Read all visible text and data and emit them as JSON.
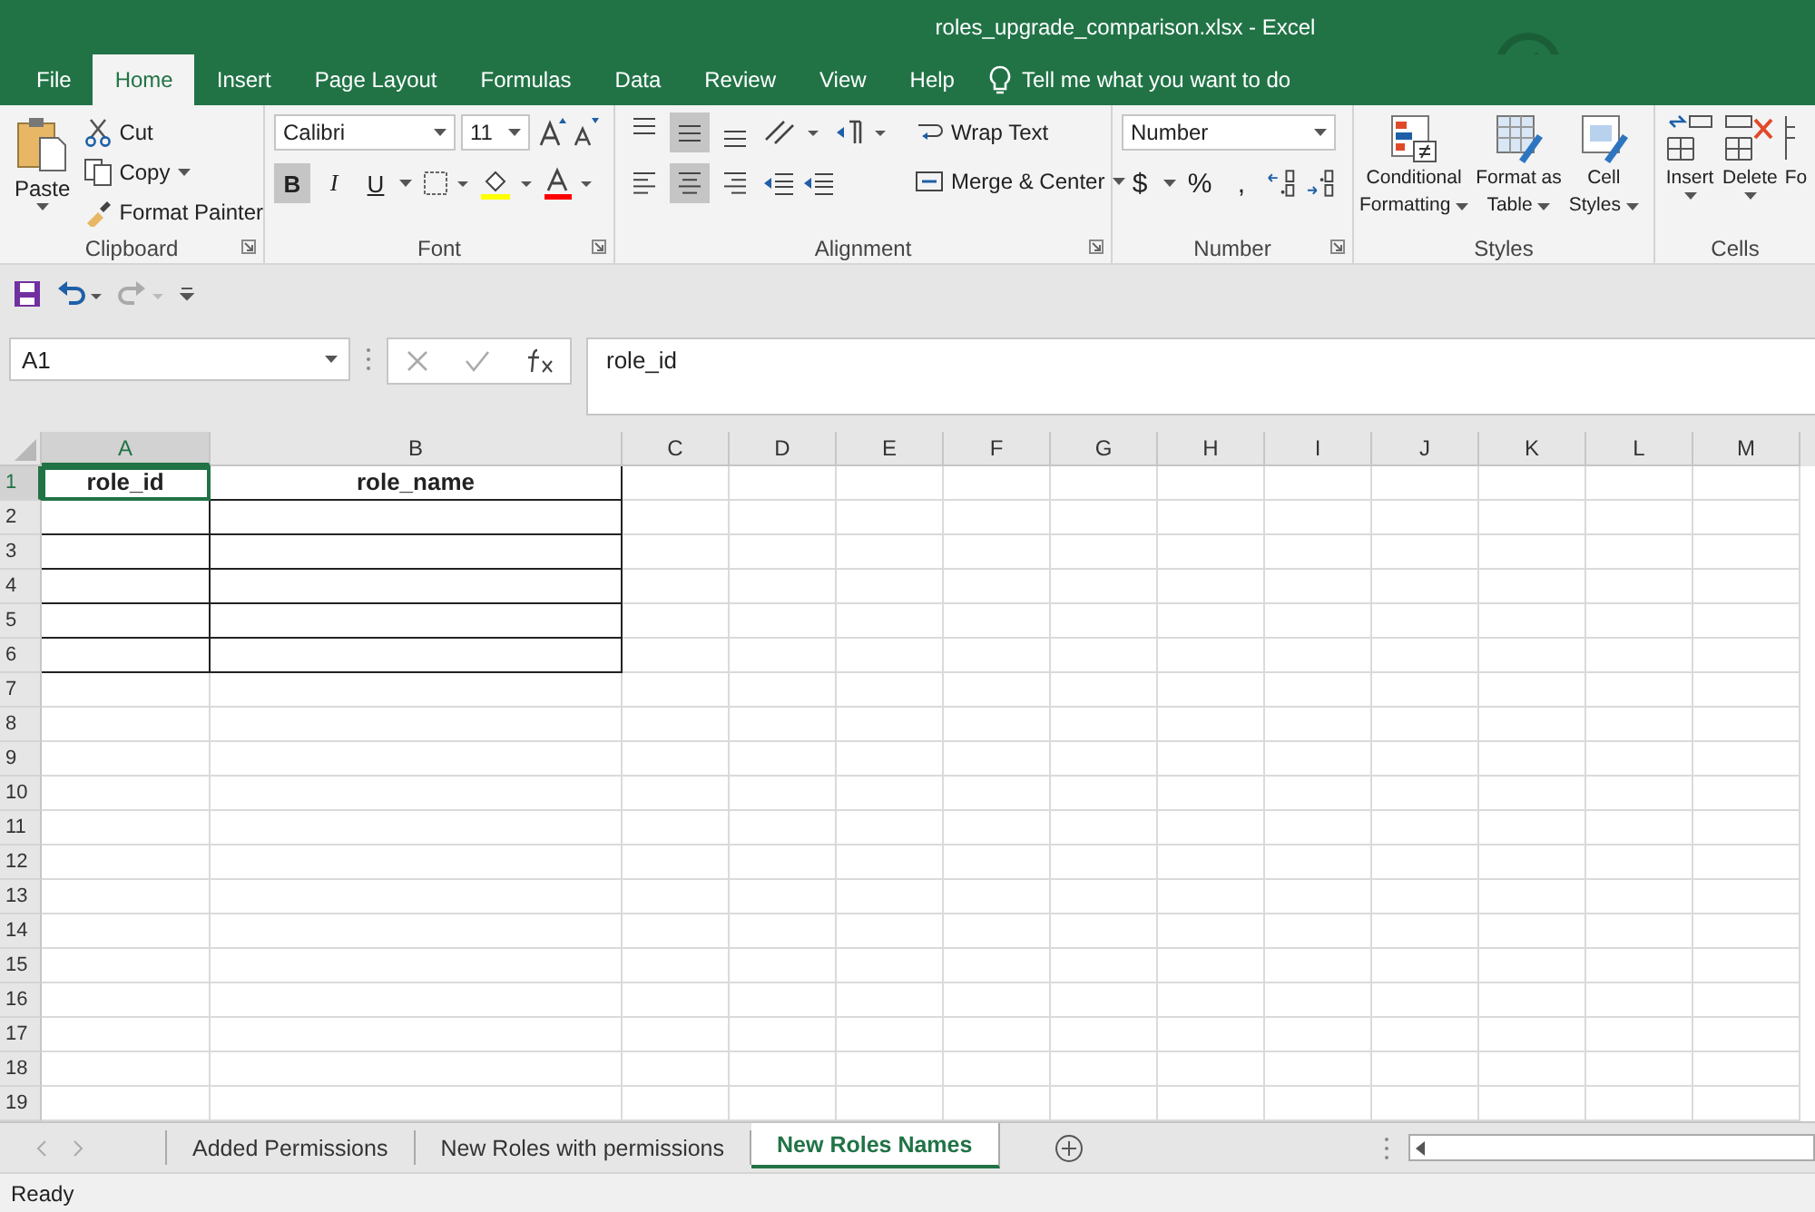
{
  "window": {
    "title": "roles_upgrade_comparison.xlsx  -  Excel"
  },
  "ribbon_tabs": [
    {
      "label": "File",
      "selected": false
    },
    {
      "label": "Home",
      "selected": true
    },
    {
      "label": "Insert",
      "selected": false
    },
    {
      "label": "Page Layout",
      "selected": false
    },
    {
      "label": "Formulas",
      "selected": false
    },
    {
      "label": "Data",
      "selected": false
    },
    {
      "label": "Review",
      "selected": false
    },
    {
      "label": "View",
      "selected": false
    },
    {
      "label": "Help",
      "selected": false
    }
  ],
  "tell_me": "Tell me what you want to do",
  "clipboard": {
    "paste": "Paste",
    "cut": "Cut",
    "copy": "Copy",
    "format_painter": "Format Painter",
    "label": "Clipboard"
  },
  "font": {
    "name": "Calibri",
    "size": "11",
    "label": "Font",
    "toggles": [
      {
        "label": "B",
        "selected": true
      },
      {
        "label": "I",
        "selected": false
      },
      {
        "label": "U",
        "selected": false
      }
    ]
  },
  "alignment": {
    "wrap_text": "Wrap Text",
    "merge_center": "Merge & Center",
    "label": "Alignment",
    "vertical": [
      {
        "kind": "top",
        "selected": false
      },
      {
        "kind": "middle",
        "selected": true
      },
      {
        "kind": "bottom",
        "selected": false
      }
    ],
    "horizontal": [
      {
        "kind": "left",
        "selected": false
      },
      {
        "kind": "center",
        "selected": true
      },
      {
        "kind": "right",
        "selected": false
      }
    ]
  },
  "number": {
    "format": "Number",
    "currency": "$",
    "percent": "%",
    "comma": ",",
    "label": "Number"
  },
  "styles": {
    "conditional_1": "Conditional",
    "conditional_2": "Formatting",
    "table_1": "Format as",
    "table_2": "Table",
    "cell_1": "Cell",
    "cell_2": "Styles",
    "label": "Styles"
  },
  "cells": {
    "insert": "Insert",
    "delete": "Delete",
    "format": "Fo",
    "label": "Cells"
  },
  "formula_bar": {
    "name_box": "A1",
    "formula": "role_id"
  },
  "grid": {
    "columns": [
      {
        "label": "A",
        "selected": true
      },
      {
        "label": "B",
        "selected": false
      },
      {
        "label": "C",
        "selected": false
      },
      {
        "label": "D",
        "selected": false
      },
      {
        "label": "E",
        "selected": false
      },
      {
        "label": "F",
        "selected": false
      },
      {
        "label": "G",
        "selected": false
      },
      {
        "label": "H",
        "selected": false
      },
      {
        "label": "I",
        "selected": false
      },
      {
        "label": "J",
        "selected": false
      },
      {
        "label": "K",
        "selected": false
      },
      {
        "label": "L",
        "selected": false
      },
      {
        "label": "M",
        "selected": false
      }
    ],
    "rows": [
      {
        "label": "1",
        "selected": true,
        "bordered": true,
        "cells": [
          "role_id",
          "role_name"
        ]
      },
      {
        "label": "2",
        "selected": false,
        "bordered": true
      },
      {
        "label": "3",
        "selected": false,
        "bordered": true
      },
      {
        "label": "4",
        "selected": false,
        "bordered": true
      },
      {
        "label": "5",
        "selected": false,
        "bordered": true
      },
      {
        "label": "6",
        "selected": false,
        "bordered": true
      },
      {
        "label": "7",
        "selected": false,
        "bordered": false
      },
      {
        "label": "8",
        "selected": false,
        "bordered": false
      },
      {
        "label": "9",
        "selected": false,
        "bordered": false
      },
      {
        "label": "10",
        "selected": false,
        "bordered": false
      },
      {
        "label": "11",
        "selected": false,
        "bordered": false
      },
      {
        "label": "12",
        "selected": false,
        "bordered": false
      },
      {
        "label": "13",
        "selected": false,
        "bordered": false
      },
      {
        "label": "14",
        "selected": false,
        "bordered": false
      },
      {
        "label": "15",
        "selected": false,
        "bordered": false
      },
      {
        "label": "16",
        "selected": false,
        "bordered": false
      },
      {
        "label": "17",
        "selected": false,
        "bordered": false
      },
      {
        "label": "18",
        "selected": false,
        "bordered": false
      },
      {
        "label": "19",
        "selected": false,
        "bordered": false
      }
    ]
  },
  "sheet_tabs": [
    {
      "label": "Added Permissions",
      "selected": false
    },
    {
      "label": "New Roles with permissions",
      "selected": false
    },
    {
      "label": "New Roles Names",
      "selected": true
    }
  ],
  "status_bar": {
    "text": "Ready"
  }
}
